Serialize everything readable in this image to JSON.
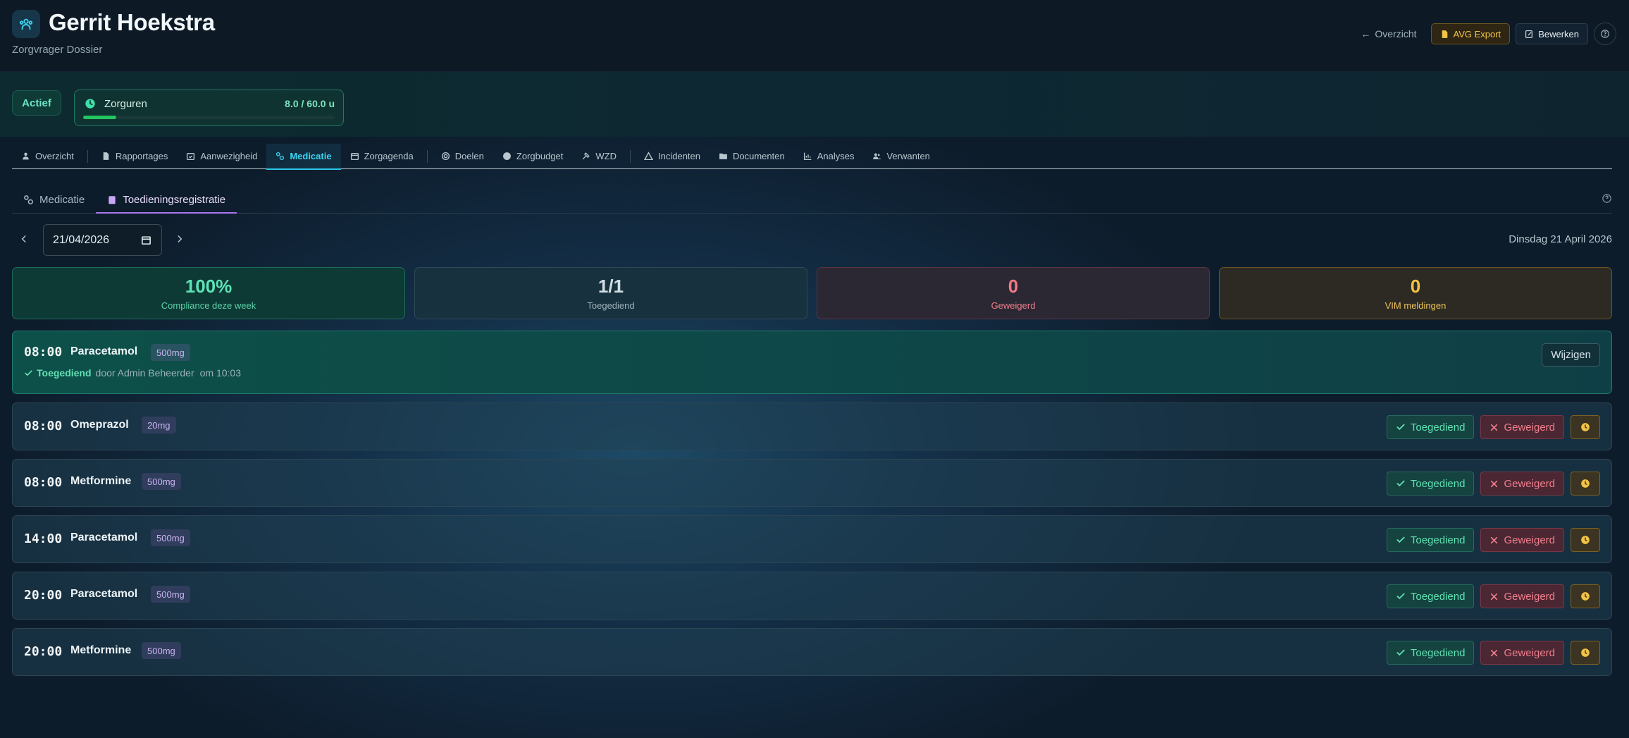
{
  "header": {
    "name": "Gerrit Hoekstra",
    "subtitle": "Zorgvrager Dossier",
    "back_label": "Overzicht",
    "avg_export_label": "AVG Export",
    "edit_label": "Bewerken"
  },
  "status": {
    "badge": "Actief",
    "hours_label": "Zorguren",
    "hours_value": "8.0 / 60.0 u",
    "hours_fraction": 0.133
  },
  "main_tabs": [
    {
      "label": "Overzicht",
      "icon": "user-icon"
    },
    {
      "label": "Rapportages",
      "icon": "file-icon"
    },
    {
      "label": "Aanwezigheid",
      "icon": "calendar-check-icon"
    },
    {
      "label": "Medicatie",
      "icon": "pill-icon",
      "active": true
    },
    {
      "label": "Zorgagenda",
      "icon": "calendar-icon"
    },
    {
      "label": "Doelen",
      "icon": "target-icon"
    },
    {
      "label": "Zorgbudget",
      "icon": "coin-icon"
    },
    {
      "label": "WZD",
      "icon": "hammer-icon"
    },
    {
      "label": "Incidenten",
      "icon": "warning-icon"
    },
    {
      "label": "Documenten",
      "icon": "folder-icon"
    },
    {
      "label": "Analyses",
      "icon": "chart-icon"
    },
    {
      "label": "Verwanten",
      "icon": "users-icon"
    }
  ],
  "sub_tabs": {
    "medicatie": "Medicatie",
    "toediening": "Toedieningsregistratie"
  },
  "date": {
    "value": "21/04/2026",
    "long": "Dinsdag 21 April 2026"
  },
  "stats": {
    "compliance_value": "100%",
    "compliance_label": "Compliance deze week",
    "given_value": "1/1",
    "given_label": "Toegediend",
    "refused_value": "0",
    "refused_label": "Geweigerd",
    "vim_value": "0",
    "vim_label": "VIM meldingen"
  },
  "actions": {
    "given": "Toegediend",
    "refused": "Geweigerd",
    "change": "Wijzigen"
  },
  "administrations": [
    {
      "time": "08:00",
      "name": "Paracetamol",
      "dose": "500mg",
      "status": "Toegediend",
      "by": "door Admin Beheerder",
      "at": "om 10:03"
    },
    {
      "time": "08:00",
      "name": "Omeprazol",
      "dose": "20mg"
    },
    {
      "time": "08:00",
      "name": "Metformine",
      "dose": "500mg"
    },
    {
      "time": "14:00",
      "name": "Paracetamol",
      "dose": "500mg"
    },
    {
      "time": "20:00",
      "name": "Paracetamol",
      "dose": "500mg"
    },
    {
      "time": "20:00",
      "name": "Metformine",
      "dose": "500mg"
    }
  ],
  "colors": {
    "accent_teal": "#2fc7e8",
    "accent_purple": "#a875f0",
    "ok_green": "#5fe3b5",
    "refuse_red": "#f37f8d",
    "amber": "#f3c246"
  }
}
